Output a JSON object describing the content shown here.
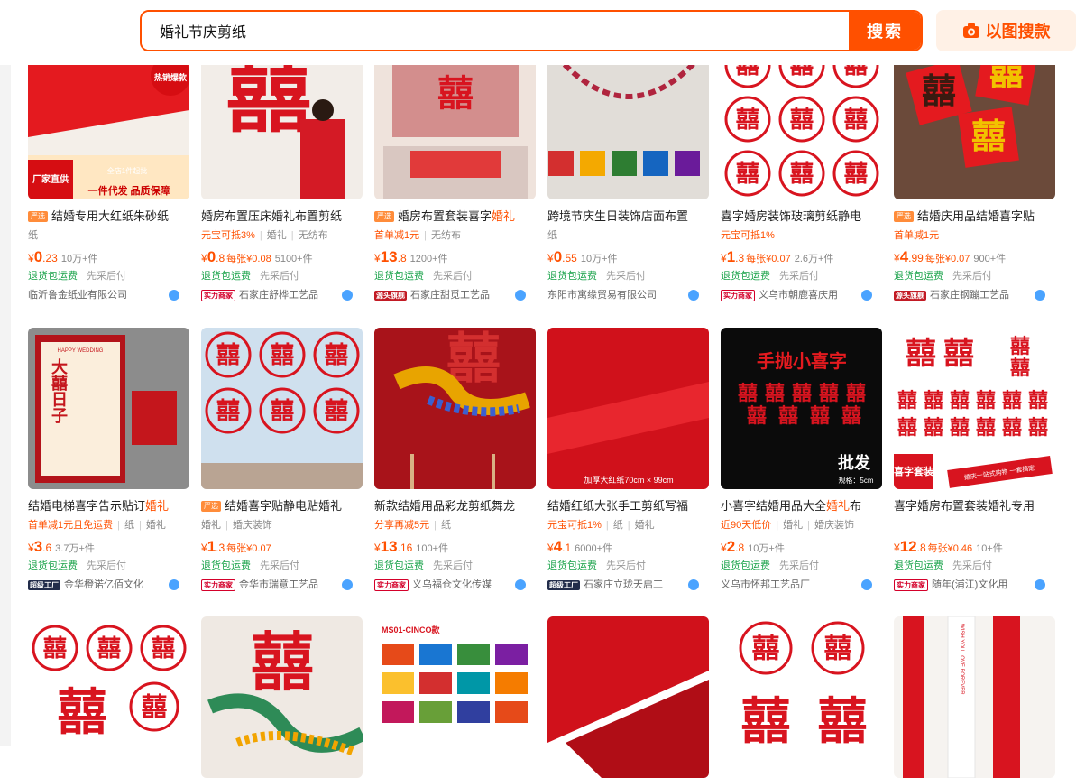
{
  "search": {
    "value": "婚礼节庆剪纸",
    "button": "搜索",
    "image_search": "以图搜款"
  },
  "colors": {
    "brand": "#ff5000",
    "green": "#1aa34a",
    "red": "#d8141f"
  },
  "rows": [
    [
      {
        "badge": "严选",
        "title": "结婚专用大红纸朱砂纸",
        "hl": "",
        "tags": [
          "纸"
        ],
        "promo": "",
        "price_int": "0",
        "price_dec": ".23",
        "per_unit": "",
        "sold": "10万+件",
        "svc_left": "退货包运费",
        "svc_right": "先采后付",
        "shop_badge": "",
        "shop": "临沂鲁金纸业有限公司",
        "thumb_text": "厂家直供",
        "thumb_sub": "一件代发 品质保障",
        "thumb_corner": "热销爆款",
        "thumb_corner_sub": "全店1件起批",
        "thumb_style": "redpaper"
      },
      {
        "badge": "",
        "title": "婚房布置压床婚礼布置剪纸",
        "hl": "",
        "tags": [
          "婚礼",
          "无纺布"
        ],
        "promo": "元宝可抵3%",
        "price_int": "0",
        "price_dec": ".8",
        "per_unit": "每张¥0.08",
        "sold": "5100+件",
        "svc_left": "退货包运费",
        "svc_right": "先采后付",
        "shop_badge": "实力商家",
        "shop": "石家庄舒桦工艺品",
        "thumb_style": "bigxi"
      },
      {
        "badge": "严选",
        "title": "婚房布置套装喜字",
        "hl": "婚礼",
        "tags": [
          "无纺布"
        ],
        "promo": "首单减1元",
        "price_int": "13",
        "price_dec": ".8",
        "per_unit": "",
        "sold": "1200+件",
        "svc_left": "退货包运费",
        "svc_right": "先采后付",
        "shop_badge": "源头旗舰",
        "shop": "石家庄甜觅工艺品",
        "thumb_style": "room"
      },
      {
        "badge": "",
        "title": "跨境节庆生日装饰店面布置",
        "hl": "",
        "tags": [
          "纸"
        ],
        "promo": "",
        "price_int": "0",
        "price_dec": ".55",
        "per_unit": "",
        "sold": "10万+件",
        "svc_left": "退货包运费",
        "svc_right": "先采后付",
        "shop_badge": "",
        "shop": "东阳市寓缘贸易有限公司",
        "thumb_style": "curtain"
      },
      {
        "badge": "",
        "title": "喜字婚房装饰玻璃剪纸静电",
        "hl": "",
        "tags": [],
        "promo": "元宝可抵1%",
        "price_int": "1",
        "price_dec": ".3",
        "per_unit": "每张¥0.07",
        "sold": "2.6万+件",
        "svc_left": "退货包运费",
        "svc_right": "先采后付",
        "shop_badge": "实力商家",
        "shop": "义乌市朝鹿喜庆用",
        "thumb_style": "circles"
      },
      {
        "badge": "严选",
        "title": "结婚庆用品结婚喜字贴",
        "hl": "",
        "tags": [],
        "promo": "首单减1元",
        "price_int": "4",
        "price_dec": ".99",
        "per_unit": "每张¥0.07",
        "sold": "900+件",
        "svc_left": "退货包运费",
        "svc_right": "先采后付",
        "shop_badge": "源头旗舰",
        "shop": "石家庄钢蹦工艺品",
        "thumb_style": "diamond"
      }
    ],
    [
      {
        "badge": "",
        "title": "结婚电梯喜字告示贴订",
        "hl": "婚礼",
        "tags": [
          "纸",
          "婚礼"
        ],
        "promo": "首单减1元且免运费",
        "price_int": "3",
        "price_dec": ".6",
        "per_unit": "",
        "sold": "3.7万+件",
        "svc_left": "退货包运费",
        "svc_right": "先采后付",
        "shop_badge": "超级工厂",
        "shop": "金华橙诺亿佰文化",
        "thumb_text": "大囍日子",
        "thumb_sub": "HAPPY WEDDING",
        "thumb_style": "elevator"
      },
      {
        "badge": "严选",
        "title": "结婚喜字贴静电贴婚礼",
        "hl": "",
        "tags": [
          "婚礼",
          "婚庆装饰"
        ],
        "promo": "",
        "price_int": "1",
        "price_dec": ".3",
        "per_unit": "每张¥0.07",
        "sold": "",
        "svc_left": "退货包运费",
        "svc_right": "先采后付",
        "shop_badge": "实力商家",
        "shop": "金华市瑞意工艺品",
        "thumb_style": "window"
      },
      {
        "badge": "",
        "title": "新款结婚用品彩龙剪纸舞龙",
        "hl": "",
        "tags": [
          "纸"
        ],
        "promo": "分享再减5元",
        "price_int": "13",
        "price_dec": ".16",
        "per_unit": "",
        "sold": "100+件",
        "svc_left": "退货包运费",
        "svc_right": "先采后付",
        "shop_badge": "实力商家",
        "shop": "义乌福仓文化传媒",
        "thumb_style": "dragon"
      },
      {
        "badge": "",
        "title": "结婚红纸大张手工剪纸写福",
        "hl": "",
        "tags": [
          "纸",
          "婚礼"
        ],
        "promo": "元宝可抵1%",
        "price_int": "4",
        "price_dec": ".1",
        "per_unit": "",
        "sold": "6000+件",
        "svc_left": "退货包运费",
        "svc_right": "先采后付",
        "shop_badge": "超级工厂",
        "shop": "石家庄立珑天启工",
        "thumb_text": "加厚大红纸70cm × 99cm",
        "thumb_style": "plainred"
      },
      {
        "badge": "",
        "title": "小喜字结婚用品大全",
        "hl": "婚礼",
        "title_tail": "布",
        "tags": [
          "婚礼",
          "婚庆装饰"
        ],
        "promo": "近90天低价",
        "price_int": "2",
        "price_dec": ".8",
        "per_unit": "",
        "sold": "10万+件",
        "svc_left": "退货包运费",
        "svc_right": "先采后付",
        "shop_badge": "",
        "shop": "义乌市怀邦工艺品厂",
        "thumb_text": "手抛小喜字",
        "thumb_sub": "批发",
        "thumb_sub2": "规格：5cm",
        "thumb_style": "dark"
      },
      {
        "badge": "",
        "title": "喜字婚房布置套装婚礼专用",
        "hl": "",
        "tags": [],
        "promo": "",
        "price_int": "12",
        "price_dec": ".8",
        "per_unit": "每张¥0.46",
        "sold": "10+件",
        "svc_left": "退货包运费",
        "svc_right": "先采后付",
        "shop_badge": "实力商家",
        "shop": "随年(浦江)文化用",
        "thumb_text": "喜字套装",
        "thumb_sub": "婚庆一站式购物 一套搞定",
        "thumb_style": "grid"
      }
    ],
    [
      {
        "thumb_style": "circles2"
      },
      {
        "thumb_style": "dragon2"
      },
      {
        "thumb_text": "MS01-CINCO款",
        "thumb_style": "flags"
      },
      {
        "thumb_style": "plainred2"
      },
      {
        "thumb_style": "xi2"
      },
      {
        "thumb_text": "WISH YOU LOVE FOREVER",
        "thumb_style": "scroll"
      }
    ]
  ]
}
